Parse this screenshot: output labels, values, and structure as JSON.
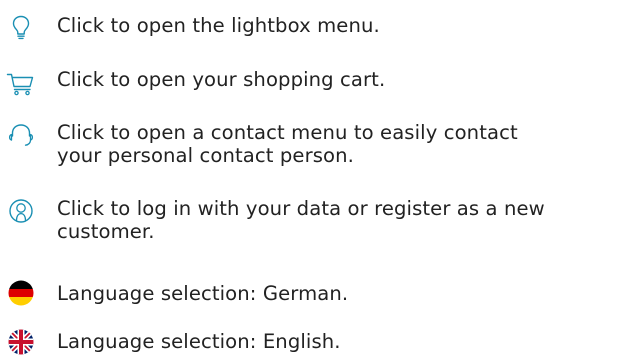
{
  "items": [
    {
      "icon": "lightbulb-icon",
      "lines": [
        "Click to open the lightbox menu."
      ]
    },
    {
      "icon": "shopping-cart-icon",
      "lines": [
        "Click to open your shopping cart."
      ]
    },
    {
      "icon": "headset-icon",
      "lines": [
        "Click to open a contact menu to easily contact",
        "your personal contact person."
      ]
    },
    {
      "icon": "user-circle-icon",
      "lines": [
        "Click to log in with your data or register as a new",
        "customer."
      ]
    },
    {
      "icon": "german-flag-icon",
      "lines": [
        "Language selection: German."
      ]
    },
    {
      "icon": "uk-flag-icon",
      "lines": [
        "Language selection: English."
      ]
    }
  ],
  "colors": {
    "icon_stroke": "#1a8fb3",
    "text": "#222222",
    "flag_de": [
      "#000000",
      "#dd0000",
      "#ffce00"
    ],
    "flag_uk": [
      "#012169",
      "#ffffff",
      "#c8102e"
    ]
  }
}
